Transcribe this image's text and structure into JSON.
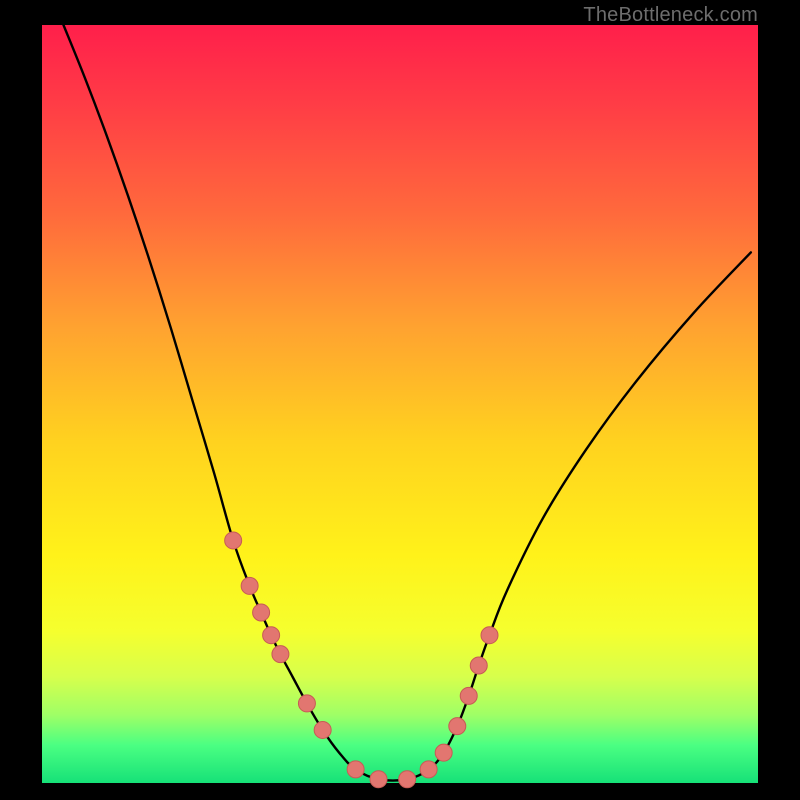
{
  "attribution": "TheBottleneck.com",
  "colors": {
    "curve": "#000000",
    "marker_fill": "#e27670",
    "marker_stroke": "#c75b55",
    "background_black": "#000000"
  },
  "chart_data": {
    "type": "line",
    "title": "",
    "xlabel": "",
    "ylabel": "",
    "xlim": [
      0,
      1
    ],
    "ylim": [
      0,
      1
    ],
    "notes": "Axes are unlabeled in the image; x and y are normalized 0..1 within the colored plot area. The curve is a V-shaped bottleneck curve descending from top-left to a flat minimum near x≈0.43–0.52, then rising to the right. Salmon-colored markers are clustered on the two walls of the V near the bottom.",
    "series": [
      {
        "name": "curve",
        "kind": "line",
        "x": [
          0.03,
          0.06,
          0.09,
          0.12,
          0.15,
          0.18,
          0.21,
          0.24,
          0.267,
          0.29,
          0.306,
          0.32,
          0.333,
          0.35,
          0.37,
          0.392,
          0.415,
          0.438,
          0.47,
          0.51,
          0.54,
          0.561,
          0.58,
          0.596,
          0.61,
          0.625,
          0.65,
          0.7,
          0.76,
          0.83,
          0.91,
          0.99
        ],
        "y": [
          1.0,
          0.93,
          0.855,
          0.775,
          0.69,
          0.6,
          0.505,
          0.41,
          0.32,
          0.26,
          0.225,
          0.195,
          0.17,
          0.14,
          0.105,
          0.07,
          0.04,
          0.018,
          0.005,
          0.005,
          0.018,
          0.04,
          0.075,
          0.115,
          0.155,
          0.195,
          0.255,
          0.35,
          0.44,
          0.53,
          0.62,
          0.7
        ]
      },
      {
        "name": "left_markers",
        "kind": "scatter",
        "x": [
          0.267,
          0.29,
          0.306,
          0.32,
          0.333,
          0.37,
          0.392,
          0.438,
          0.47,
          0.51
        ],
        "y": [
          0.32,
          0.26,
          0.225,
          0.195,
          0.17,
          0.105,
          0.07,
          0.018,
          0.005,
          0.005
        ]
      },
      {
        "name": "right_markers",
        "kind": "scatter",
        "x": [
          0.54,
          0.561,
          0.58,
          0.596,
          0.61,
          0.625
        ],
        "y": [
          0.018,
          0.04,
          0.075,
          0.115,
          0.155,
          0.195
        ]
      }
    ]
  }
}
